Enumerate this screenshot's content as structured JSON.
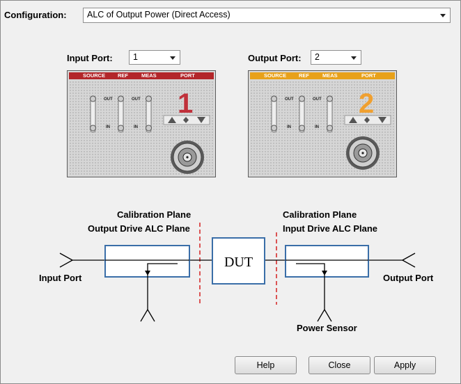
{
  "config": {
    "label": "Configuration:",
    "value": "ALC of Output Power (Direct Access)"
  },
  "input_port": {
    "label": "Input Port:",
    "value": "1",
    "panel_labels": [
      "SOURCE",
      "REF",
      "MEAS",
      "PORT"
    ],
    "port_number": "1",
    "header_color": "#b3262a",
    "number_color": "#c0303a"
  },
  "output_port": {
    "label": "Output Port:",
    "value": "2",
    "panel_labels": [
      "SOURCE",
      "REF",
      "MEAS",
      "PORT"
    ],
    "port_number": "2",
    "header_color": "#e8a11a",
    "number_color": "#f0a030"
  },
  "switch_labels": {
    "out": "OUT",
    "in": "IN"
  },
  "diagram": {
    "left_plane_line1": "Calibration Plane",
    "left_plane_line2": "Output Drive ALC Plane",
    "right_plane_line1": "Calibration Plane",
    "right_plane_line2": "Input Drive ALC Plane",
    "dut": "DUT",
    "input_port": "Input Port",
    "output_port": "Output Port",
    "power_sensor": "Power Sensor",
    "plane_color": "#d42020"
  },
  "buttons": {
    "help": "Help",
    "close": "Close",
    "apply": "Apply"
  }
}
